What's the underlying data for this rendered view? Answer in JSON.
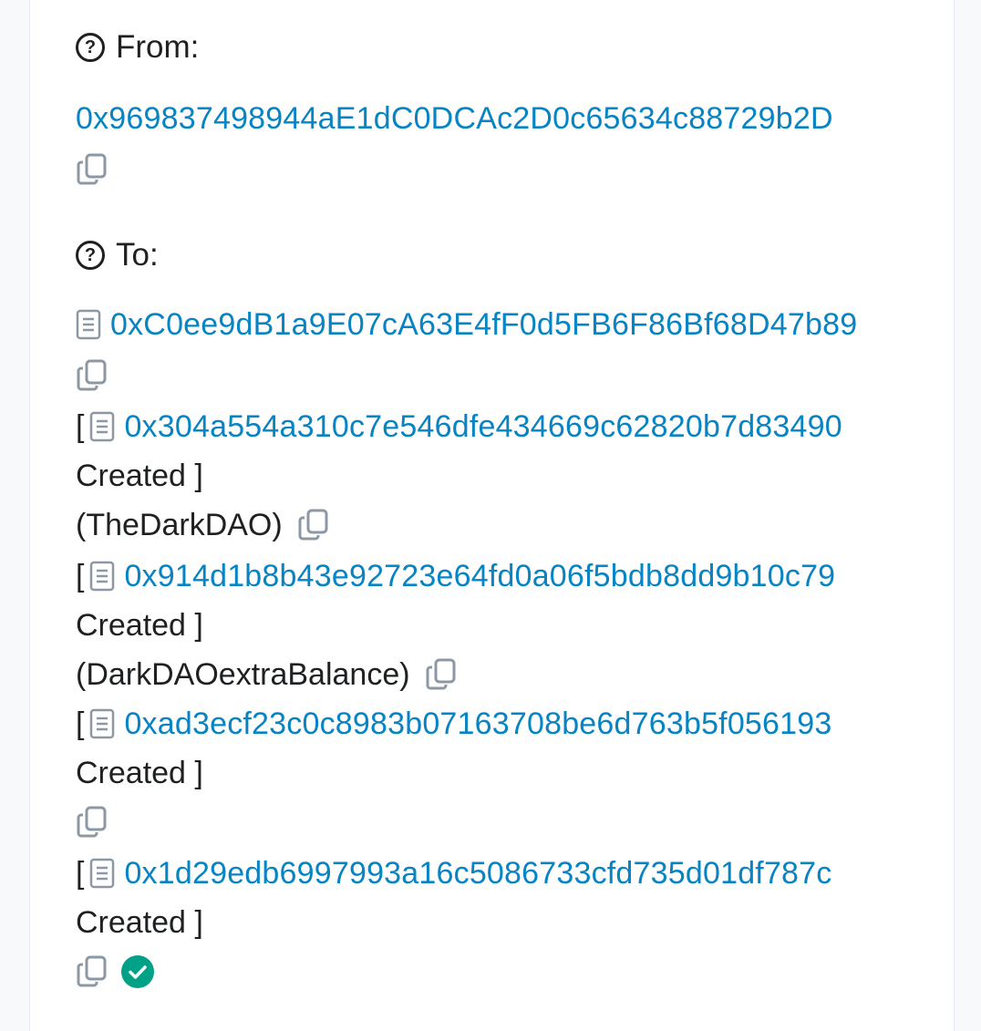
{
  "from": {
    "label": "From:",
    "address": "0x969837498944aE1dC0DCAc2D0c65634c88729b2D"
  },
  "to": {
    "label": "To:",
    "address": "0xC0ee9dB1a9E07cA63E4fF0d5FB6F86Bf68D47b89",
    "created": [
      {
        "open": "[",
        "address": "0x304a554a310c7e546dfe434669c62820b7d83490",
        "created_text": "Created ]",
        "name": "(TheDarkDAO)"
      },
      {
        "open": "[",
        "address": "0x914d1b8b43e92723e64fd0a06f5bdb8dd9b10c79",
        "created_text": "Created ]",
        "name": "(DarkDAOextraBalance)"
      },
      {
        "open": "[",
        "address": "0xad3ecf23c0c8983b07163708be6d763b5f056193",
        "created_text": "Created ]",
        "name": ""
      },
      {
        "open": "[",
        "address": "0x1d29edb6997993a16c5086733cfd735d01df787c",
        "created_text": "Created ]",
        "name": ""
      }
    ]
  },
  "colors": {
    "link": "#0784c3",
    "text": "#1e2022",
    "icon": "#8c98a4",
    "success": "#00a186"
  },
  "icons": {
    "help": "question-circle-icon",
    "copy": "copy-icon",
    "contract": "file-contract-icon",
    "verified": "check-circle-icon"
  }
}
